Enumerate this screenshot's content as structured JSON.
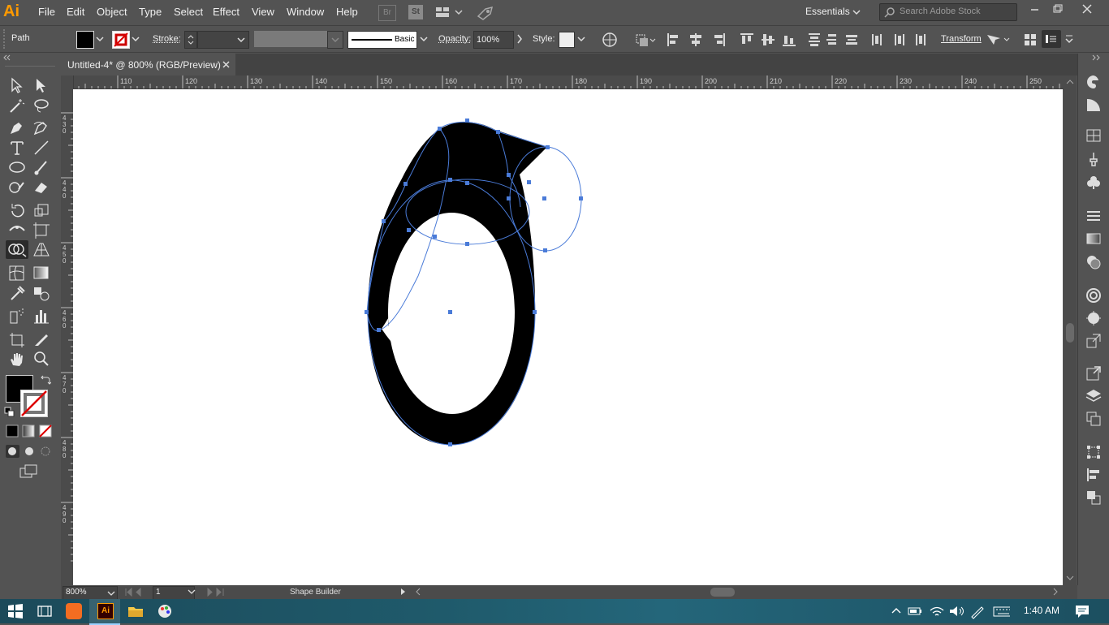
{
  "app": {
    "logo": "Ai"
  },
  "menu": [
    "File",
    "Edit",
    "Object",
    "Type",
    "Select",
    "Effect",
    "View",
    "Window",
    "Help"
  ],
  "bridge_badges": [
    "Br",
    "St"
  ],
  "workspace": "Essentials",
  "search": {
    "placeholder": "Search Adobe Stock"
  },
  "control": {
    "selection_type": "Path",
    "stroke_label": "Stroke:",
    "brush_label": "Basic",
    "opacity_label": "Opacity:",
    "opacity_value": "100%",
    "style_label": "Style:",
    "transform_label": "Transform"
  },
  "document": {
    "tab_title": "Untitled-4* @ 800% (RGB/Preview)"
  },
  "ruler": {
    "h_labels": [
      "110",
      "120",
      "130",
      "140",
      "150",
      "160",
      "170",
      "180",
      "190",
      "200",
      "210",
      "220",
      "230",
      "240",
      "250"
    ],
    "v_labels": [
      "4\n3\n0",
      "4\n4\n0",
      "4\n5\n0",
      "4\n6\n0",
      "4\n7\n0",
      "4\n8\n0",
      "4\n9\n0"
    ]
  },
  "status": {
    "zoom": "800%",
    "artboard": "1",
    "active_tool": "Shape Builder"
  },
  "taskbar": {
    "time": "1:40 AM"
  },
  "colors": {
    "accent_selection": "#4a7bd8",
    "fill": "#000000",
    "app_orange": "#ff9a00"
  }
}
